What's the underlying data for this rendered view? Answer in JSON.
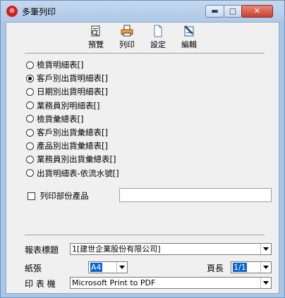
{
  "window": {
    "title": "多筆列印",
    "app_icon": "app-logo-icon"
  },
  "titlebar_buttons": {
    "minimize": "▬",
    "maximize": "□",
    "close": "✕"
  },
  "toolbar": {
    "preview": "預覽",
    "print": "列印",
    "settings": "設定",
    "edit": "編輯"
  },
  "report_options": {
    "selected_index": 1,
    "items": [
      "檢貨明細表[]",
      "客戶別出貨明細表[]",
      "日期別出貨明細表[]",
      "業務員別明細表[]",
      "檢貨彙總表[]",
      "客戶別出貨彙總表[]",
      "產品別出貨彙總表[]",
      "業務員別出貨彙總表[]",
      "出貨明細表-依流水號[]"
    ]
  },
  "partial_print": {
    "label": "列印部份產品",
    "checked": false,
    "value": ""
  },
  "report_title": {
    "label": "報表標題",
    "value": "1[建世企業股份有限公司]"
  },
  "paper": {
    "label": "紙張",
    "value": "A4"
  },
  "page_length": {
    "label": "頁長",
    "value": "1/1"
  },
  "printer": {
    "label": "印 表 機",
    "value": "Microsoft Print to PDF"
  }
}
